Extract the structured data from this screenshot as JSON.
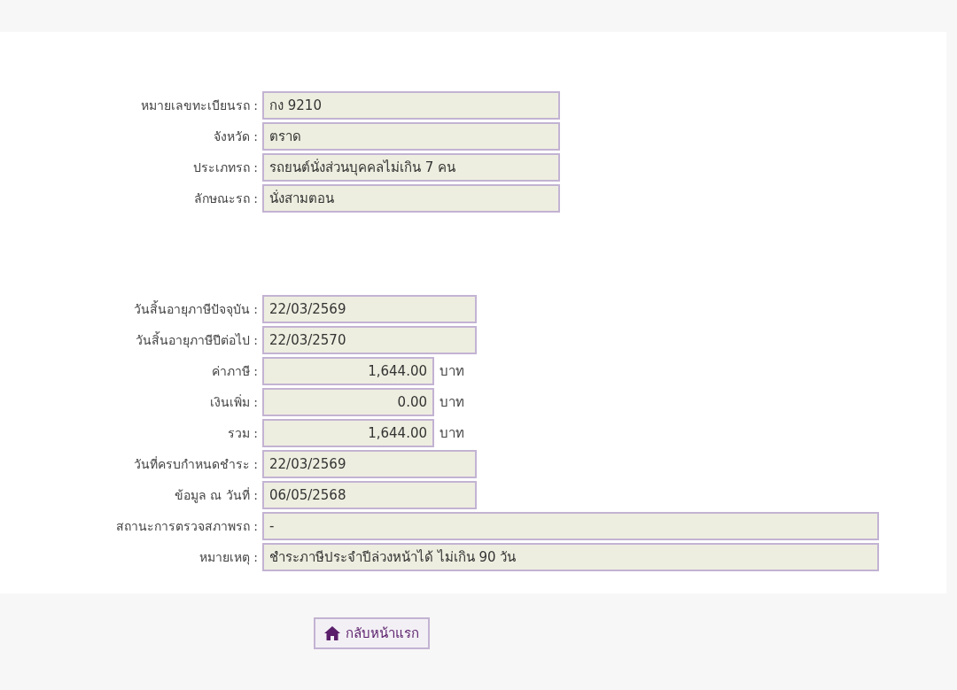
{
  "sections": [
    {
      "rows": [
        {
          "label": "หมายเลขทะเบียนรถ :",
          "value": "กง 9210",
          "kind": "medium"
        },
        {
          "label": "จังหวัด :",
          "value": "ตราด",
          "kind": "medium"
        },
        {
          "label": "ประเภทรถ :",
          "value": "รถยนต์นั่งส่วนบุคคลไม่เกิน 7 คน",
          "kind": "medium"
        },
        {
          "label": "ลักษณะรถ :",
          "value": "นั่งสามตอน",
          "kind": "medium"
        }
      ]
    },
    {
      "rows": [
        {
          "label": "วันสิ้นอายุภาษีปัจจุบัน :",
          "value": "22/03/2569",
          "kind": "date"
        },
        {
          "label": "วันสิ้นอายุภาษีปีต่อไป :",
          "value": "22/03/2570",
          "kind": "date"
        },
        {
          "label": "ค่าภาษี :",
          "value": "1,644.00",
          "kind": "money",
          "unit": "บาท"
        },
        {
          "label": "เงินเพิ่ม :",
          "value": "0.00",
          "kind": "money",
          "unit": "บาท"
        },
        {
          "label": "รวม :",
          "value": "1,644.00",
          "kind": "money",
          "unit": "บาท"
        },
        {
          "label": "วันที่ครบกำหนดชำระ :",
          "value": "22/03/2569",
          "kind": "date"
        },
        {
          "label": "ข้อมูล ณ วันที่ :",
          "value": "06/05/2568",
          "kind": "date"
        },
        {
          "label": "สถานะการตรวจสภาพรถ :",
          "value": "-",
          "kind": "wide"
        },
        {
          "label": "หมายเหตุ :",
          "value": "ชำระภาษีประจำปีล่วงหน้าได้ ไม่เกิน 90 วัน",
          "kind": "wide"
        }
      ]
    }
  ],
  "home_button": {
    "label": "กลับหน้าแรก"
  }
}
